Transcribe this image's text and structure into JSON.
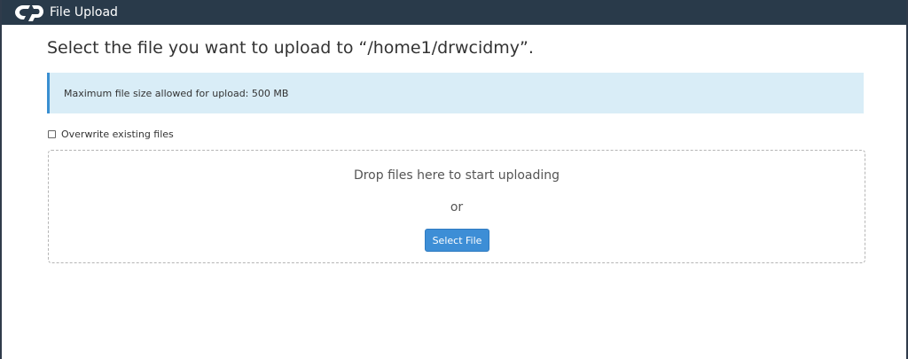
{
  "header": {
    "title": "File Upload",
    "logo_icon": "cpanel-logo-icon"
  },
  "main": {
    "title": "Select the file you want to upload to “/home1/drwcidmy”.",
    "info": "Maximum file size allowed for upload: 500 MB",
    "overwrite_label": "Overwrite existing files",
    "overwrite_checked": false,
    "drop_text": "Drop files here to start uploading",
    "or_text": "or",
    "select_button": "Select File"
  },
  "colors": {
    "header_bg": "#293a4a",
    "info_bg": "#d9edf7",
    "info_border": "#3a8fd1",
    "button_bg": "#3d8ed6"
  }
}
